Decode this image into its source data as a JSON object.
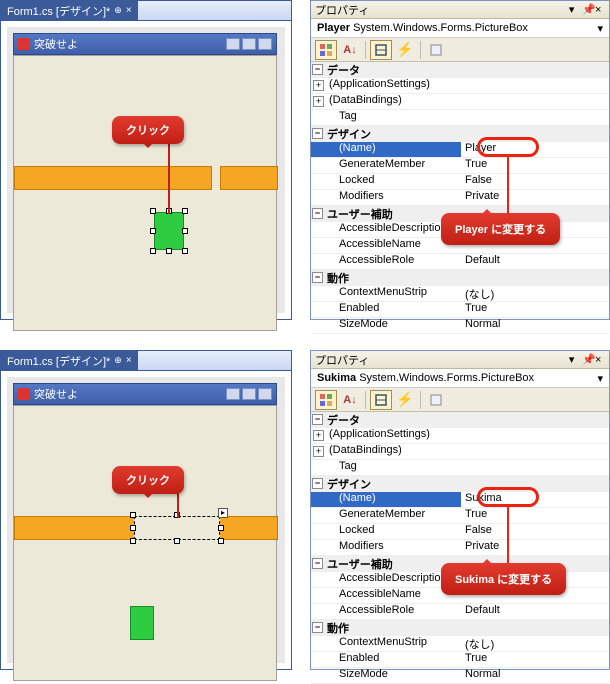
{
  "panels": [
    {
      "designer": {
        "tab_label": "Form1.cs [デザイン]*",
        "form_title": "突破せよ",
        "click_label": "クリック",
        "selected": "player"
      },
      "props": {
        "title": "プロパティ",
        "object_name": "Player",
        "object_type": "System.Windows.Forms.PictureBox",
        "instruction": "Player  に変更する",
        "name_value": "Player",
        "categories": [
          {
            "exp": "−",
            "label": "データ",
            "rows": [
              {
                "exp": "+",
                "k": "(ApplicationSettings)",
                "v": ""
              },
              {
                "exp": "+",
                "k": "(DataBindings)",
                "v": ""
              },
              {
                "k": "Tag",
                "v": ""
              }
            ]
          },
          {
            "exp": "−",
            "label": "デザイン",
            "rows": [
              {
                "name": true,
                "k": "(Name)",
                "v": "Player"
              },
              {
                "k": "GenerateMember",
                "v": "True"
              },
              {
                "k": "Locked",
                "v": "False"
              },
              {
                "k": "Modifiers",
                "v": "Private"
              }
            ]
          },
          {
            "exp": "−",
            "label": "ユーザー補助",
            "rows": [
              {
                "k": "AccessibleDescription",
                "v": ""
              },
              {
                "k": "AccessibleName",
                "v": ""
              },
              {
                "k": "AccessibleRole",
                "v": "Default"
              }
            ]
          },
          {
            "exp": "−",
            "label": "動作",
            "rows": [
              {
                "k": "ContextMenuStrip",
                "v": "(なし)"
              },
              {
                "k": "Enabled",
                "v": "True"
              },
              {
                "k": "SizeMode",
                "v": "Normal"
              }
            ]
          }
        ]
      }
    },
    {
      "designer": {
        "tab_label": "Form1.cs [デザイン]*",
        "form_title": "突破せよ",
        "click_label": "クリック",
        "selected": "sukima"
      },
      "props": {
        "title": "プロパティ",
        "object_name": "Sukima",
        "object_type": "System.Windows.Forms.PictureBox",
        "instruction": "Sukima  に変更する",
        "name_value": "Sukima",
        "categories": [
          {
            "exp": "−",
            "label": "データ",
            "rows": [
              {
                "exp": "+",
                "k": "(ApplicationSettings)",
                "v": ""
              },
              {
                "exp": "+",
                "k": "(DataBindings)",
                "v": ""
              },
              {
                "k": "Tag",
                "v": ""
              }
            ]
          },
          {
            "exp": "−",
            "label": "デザイン",
            "rows": [
              {
                "name": true,
                "k": "(Name)",
                "v": "Sukima"
              },
              {
                "k": "GenerateMember",
                "v": "True"
              },
              {
                "k": "Locked",
                "v": "False"
              },
              {
                "k": "Modifiers",
                "v": "Private"
              }
            ]
          },
          {
            "exp": "−",
            "label": "ユーザー補助",
            "rows": [
              {
                "k": "AccessibleDescription",
                "v": ""
              },
              {
                "k": "AccessibleName",
                "v": ""
              },
              {
                "k": "AccessibleRole",
                "v": "Default"
              }
            ]
          },
          {
            "exp": "−",
            "label": "動作",
            "rows": [
              {
                "k": "ContextMenuStrip",
                "v": "(なし)"
              },
              {
                "k": "Enabled",
                "v": "True"
              },
              {
                "k": "SizeMode",
                "v": "Normal"
              }
            ]
          }
        ]
      }
    }
  ]
}
